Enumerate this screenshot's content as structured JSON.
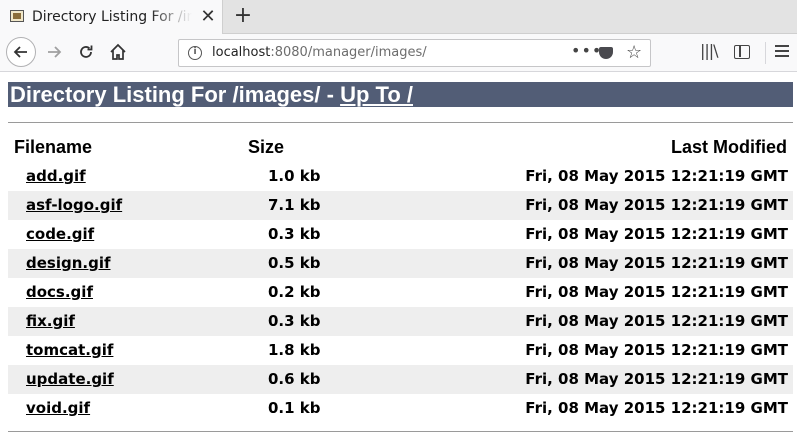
{
  "browser": {
    "tab": {
      "title": "Directory Listing For /images/",
      "close_glyph": "✕"
    },
    "new_tab_glyph": "+",
    "url": {
      "host": "localhost",
      "rest": ":8080/manager/images/"
    },
    "url_dots": "•••"
  },
  "page": {
    "heading_prefix": "Directory Listing For /images/ - ",
    "heading_link": "Up To /",
    "columns": {
      "name": "Filename",
      "size": "Size",
      "modified": "Last Modified"
    },
    "files": [
      {
        "name": "add.gif",
        "size": "1.0 kb",
        "modified": "Fri, 08 May 2015 12:21:19 GMT"
      },
      {
        "name": "asf-logo.gif",
        "size": "7.1 kb",
        "modified": "Fri, 08 May 2015 12:21:19 GMT"
      },
      {
        "name": "code.gif",
        "size": "0.3 kb",
        "modified": "Fri, 08 May 2015 12:21:19 GMT"
      },
      {
        "name": "design.gif",
        "size": "0.5 kb",
        "modified": "Fri, 08 May 2015 12:21:19 GMT"
      },
      {
        "name": "docs.gif",
        "size": "0.2 kb",
        "modified": "Fri, 08 May 2015 12:21:19 GMT"
      },
      {
        "name": "fix.gif",
        "size": "0.3 kb",
        "modified": "Fri, 08 May 2015 12:21:19 GMT"
      },
      {
        "name": "tomcat.gif",
        "size": "1.8 kb",
        "modified": "Fri, 08 May 2015 12:21:19 GMT"
      },
      {
        "name": "update.gif",
        "size": "0.6 kb",
        "modified": "Fri, 08 May 2015 12:21:19 GMT"
      },
      {
        "name": "void.gif",
        "size": "0.1 kb",
        "modified": "Fri, 08 May 2015 12:21:19 GMT"
      }
    ]
  },
  "colors": {
    "heading_bg": "#525d76",
    "row_shade": "#eeeeee"
  },
  "icons": [
    "tomcat-favicon-icon",
    "info-icon",
    "pocket-icon",
    "bookmark-star-icon",
    "library-icon",
    "sidebar-icon",
    "hamburger-menu-icon"
  ]
}
